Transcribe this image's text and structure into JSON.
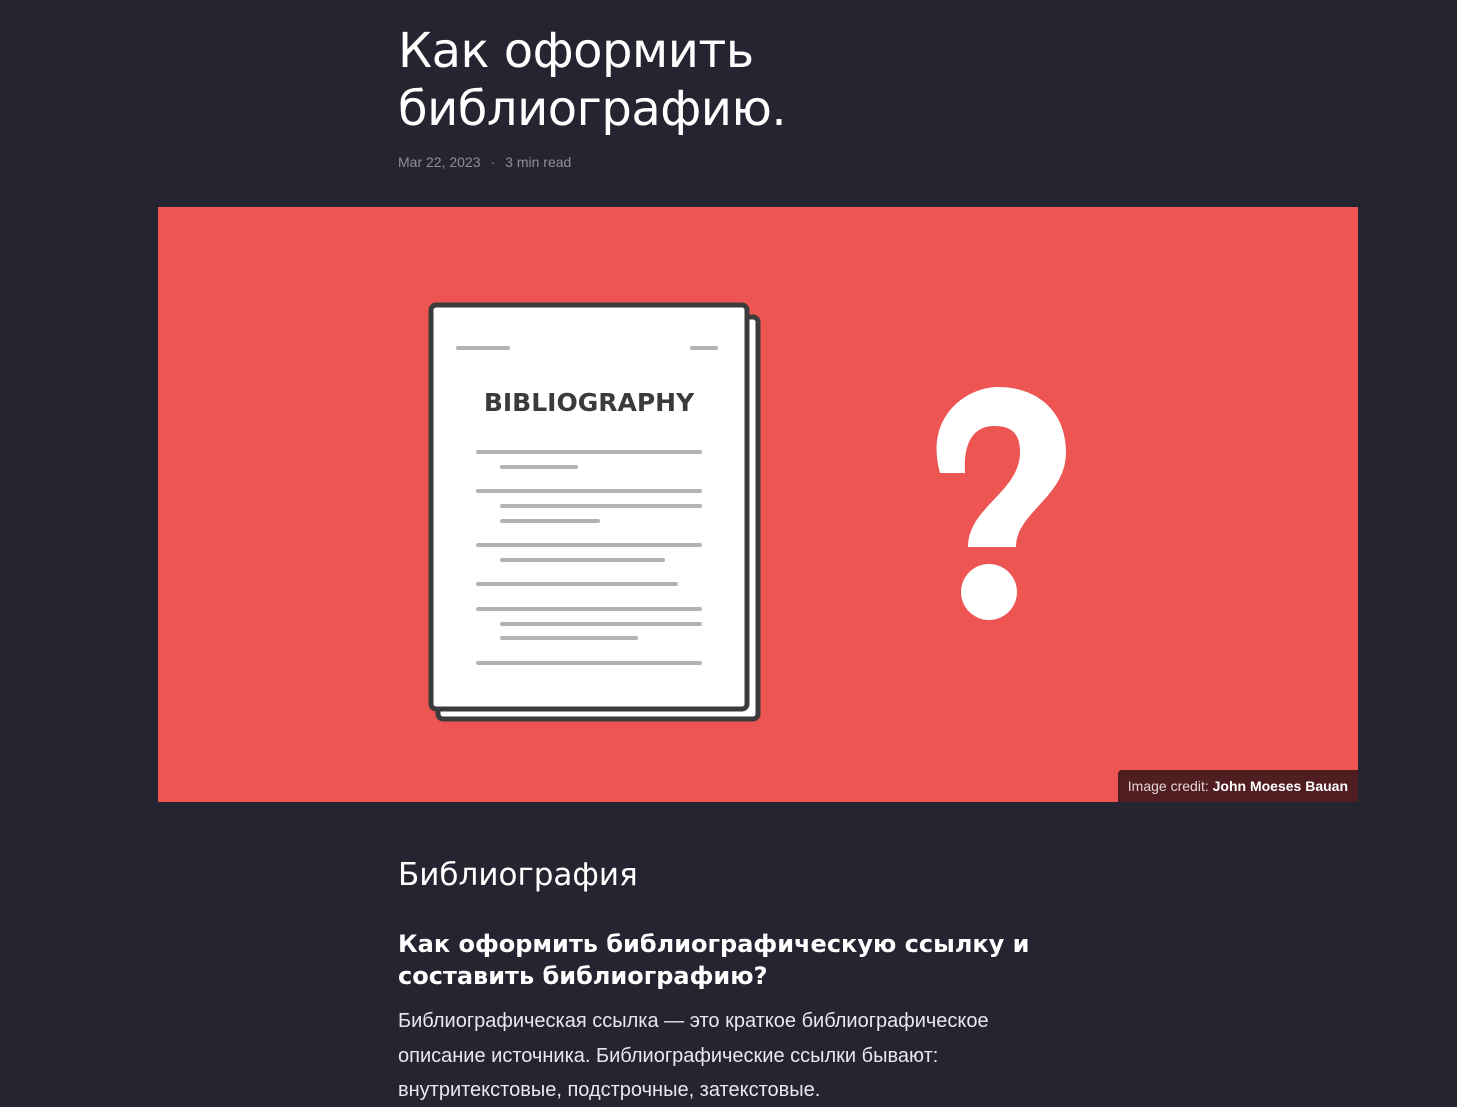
{
  "article": {
    "title": "Как оформить библиографию.",
    "date": "Mar 22, 2023",
    "separator": "·",
    "read_time": "3 min read"
  },
  "hero": {
    "background_color": "#ec5552",
    "document_heading": "BIBLIOGRAPHY",
    "illustration_icon": "bibliography-document-icon",
    "symbol_icon": "question-mark-icon",
    "credit_label": "Image credit:",
    "credit_author": "John Moeses Bauan"
  },
  "content": {
    "section_title": "Библиография",
    "subheading": "Как оформить библиографическую ссылку и составить библиографию?",
    "paragraph": "Библиографическая ссылка — это краткое библиографическое описание источника. Библиографические ссылки бывают: внутритекстовые, подстрочные, затекстовые."
  },
  "colors": {
    "page_background": "#242530",
    "meta_text": "#8e8f99",
    "credit_background": "#501d21"
  }
}
